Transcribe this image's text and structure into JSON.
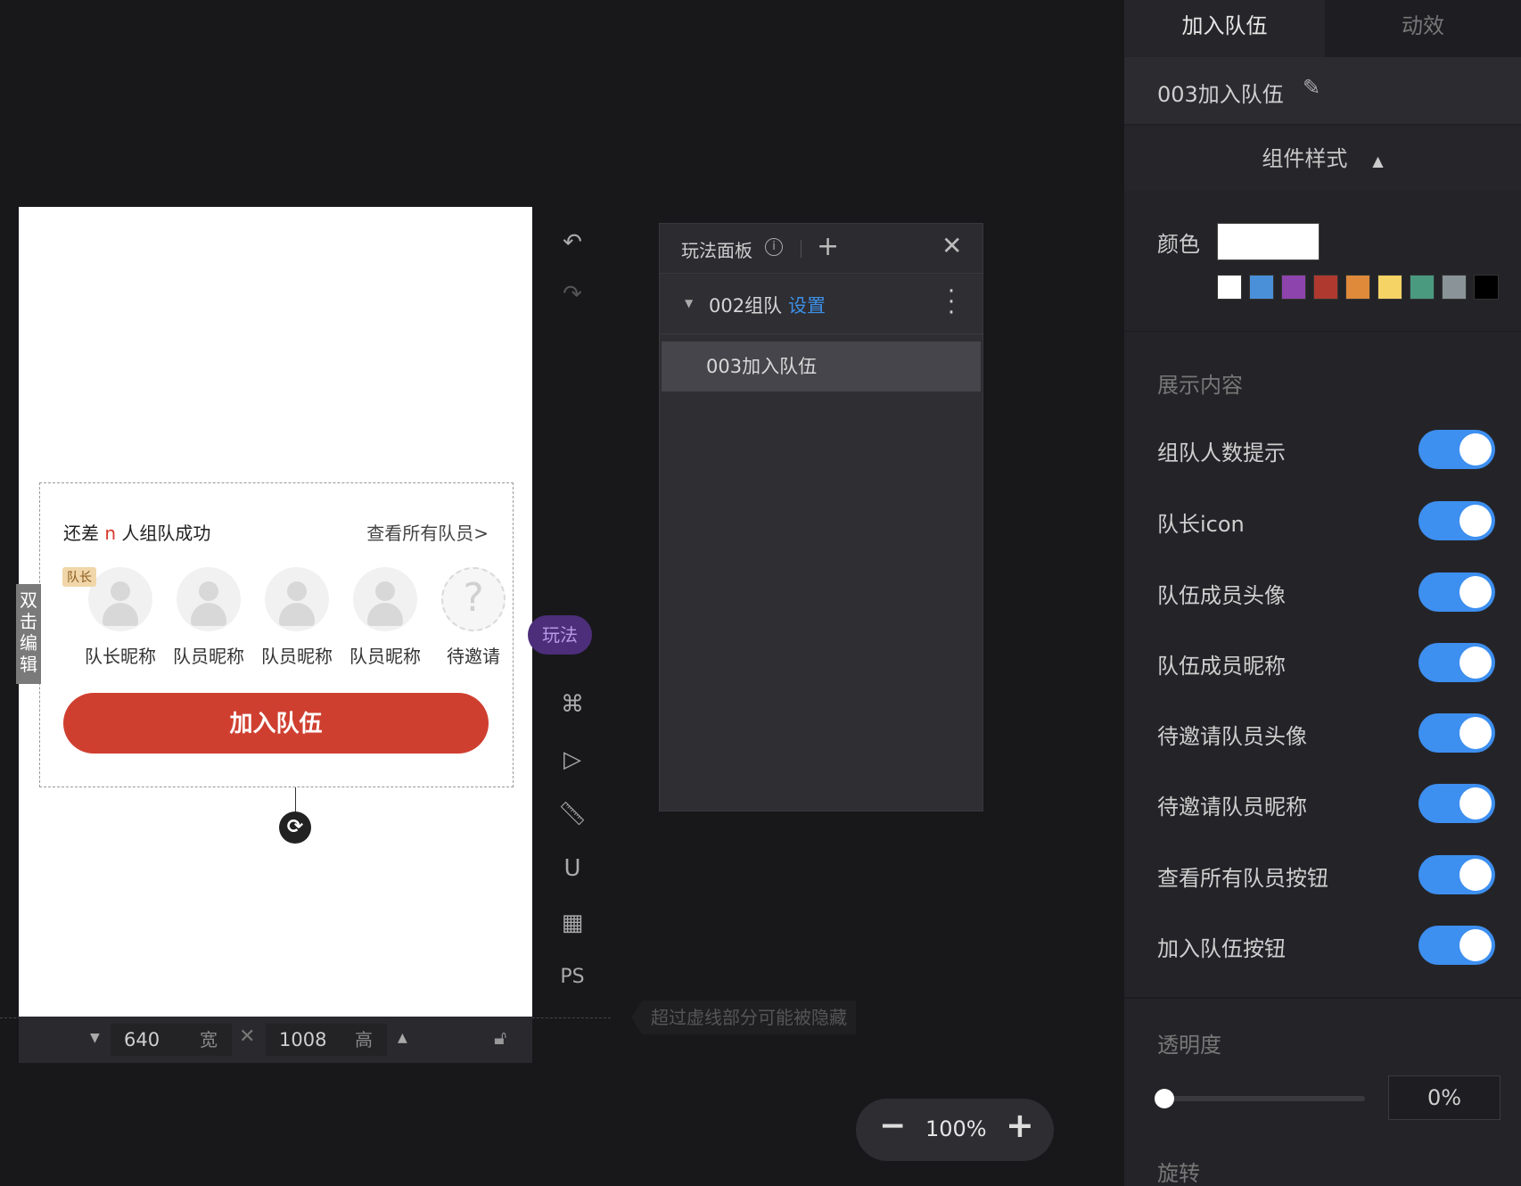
{
  "canvas": {
    "team_tip_prefix": "还差",
    "team_tip_n": "n",
    "team_tip_suffix": "人组队成功",
    "view_all": "查看所有队员>",
    "captain_tag": "队长",
    "members": [
      {
        "nick": "队长昵称"
      },
      {
        "nick": "队员昵称"
      },
      {
        "nick": "队员昵称"
      },
      {
        "nick": "队员昵称"
      },
      {
        "nick": "待邀请",
        "invite_glyph": "?"
      }
    ],
    "join_button": "加入队伍",
    "double_click_edit": "双击编辑",
    "rotate_icon": "rotate-icon"
  },
  "size_bar": {
    "width_value": "640",
    "width_unit": "宽",
    "height_value": "1008",
    "height_unit": "高",
    "hidden_hint": "超过虚线部分可能被隐藏"
  },
  "toolbar": {
    "play_badge": "玩法",
    "ps_label": "PS",
    "icons": [
      "undo-icon",
      "redo-icon",
      "command-icon",
      "play-icon",
      "ruler-icon",
      "magnet-icon",
      "grid-icon"
    ]
  },
  "play_panel": {
    "title": "玩法面板",
    "group_name": "002组队",
    "group_setting": "设置",
    "item_name": "003加入队伍"
  },
  "zoom": {
    "value": "100%"
  },
  "props": {
    "tabs": [
      {
        "label": "加入队伍",
        "active": true
      },
      {
        "label": "动效",
        "active": false
      }
    ],
    "component_name": "003加入队伍",
    "section_title": "组件样式",
    "color_label": "颜色",
    "color_value": "#ffffff",
    "swatches": [
      "#ffffff",
      "#4a90d9",
      "#8e44ad",
      "#b0392f",
      "#de8a3a",
      "#f6d365",
      "#4a9a80",
      "#8a9397",
      "#000000"
    ],
    "display_label": "展示内容",
    "toggles": [
      {
        "label": "组队人数提示",
        "on": true
      },
      {
        "label": "队长icon",
        "on": true
      },
      {
        "label": "队伍成员头像",
        "on": true
      },
      {
        "label": "队伍成员昵称",
        "on": true
      },
      {
        "label": "待邀请队员头像",
        "on": true
      },
      {
        "label": "待邀请队员昵称",
        "on": true
      },
      {
        "label": "查看所有队员按钮",
        "on": true
      },
      {
        "label": "加入队伍按钮",
        "on": true
      }
    ],
    "opacity_label": "透明度",
    "opacity_value": "0%",
    "rotate_label": "旋转"
  }
}
